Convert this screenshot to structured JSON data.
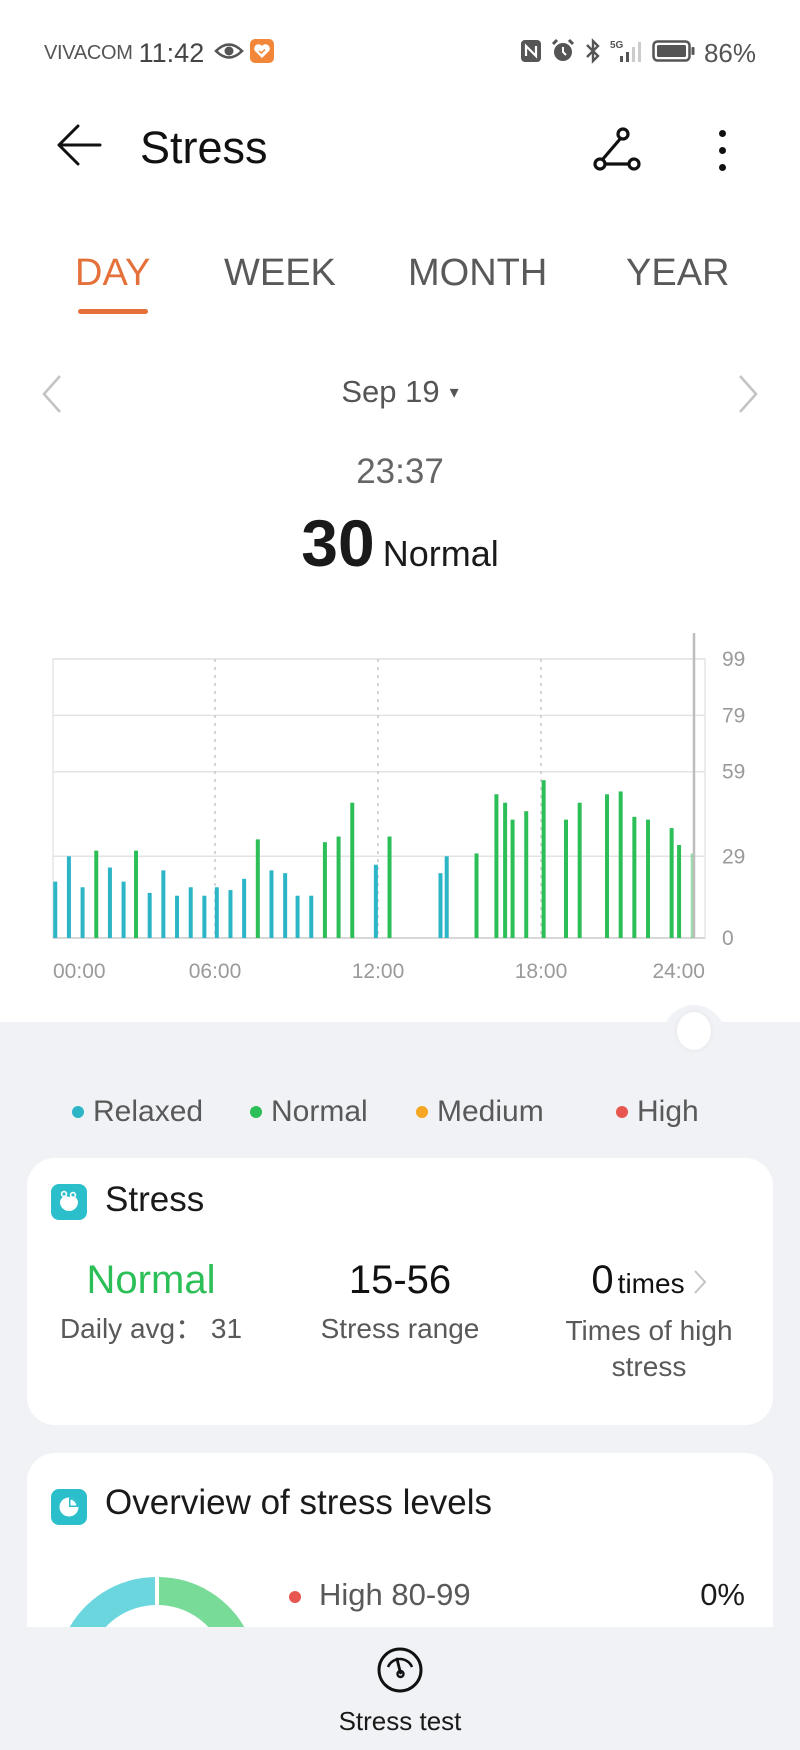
{
  "status_bar": {
    "carrier": "VIVACOM",
    "time": "11:42",
    "icons_left": [
      "eye-icon",
      "health-app-notification-icon"
    ],
    "icons_right": [
      "nfc-icon",
      "alarm-icon",
      "bluetooth-icon",
      "5g-signal-icon",
      "battery-icon"
    ],
    "battery_percent": "86%"
  },
  "header": {
    "title": "Stress",
    "back_icon": "arrow-left-icon",
    "share_icon": "share-icon",
    "more_icon": "more-vertical-icon"
  },
  "tabs": [
    {
      "label": "DAY",
      "active": true
    },
    {
      "label": "WEEK",
      "active": false
    },
    {
      "label": "MONTH",
      "active": false
    },
    {
      "label": "YEAR",
      "active": false
    }
  ],
  "date_nav": {
    "date": "Sep 19",
    "caret": "▾"
  },
  "reading": {
    "time": "23:37",
    "value": "30",
    "level": "Normal"
  },
  "colors": {
    "accent": "#e4703a",
    "relaxed": "#2bb5c6",
    "normal": "#2dbf57",
    "medium": "#f5a623",
    "high": "#e85650",
    "card_icon": "#2bbfcc",
    "background_gray": "#f1f2f6"
  },
  "chart_data": {
    "type": "bar",
    "title": "",
    "xlabel": "",
    "ylabel": "",
    "x_unit": "hour of day",
    "xlim": [
      0,
      24
    ],
    "ylim": [
      0,
      99
    ],
    "y_ticks": [
      0,
      29,
      59,
      79,
      99
    ],
    "x_ticks": [
      "00:00",
      "06:00",
      "12:00",
      "18:00",
      "24:00"
    ],
    "grid": true,
    "selected_time": "23:37",
    "bars": [
      {
        "t": 0.05,
        "value": 20,
        "level": "relaxed"
      },
      {
        "t": 0.6,
        "value": 29,
        "level": "relaxed"
      },
      {
        "t": 1.15,
        "value": 18,
        "level": "relaxed"
      },
      {
        "t": 1.7,
        "value": 31,
        "level": "normal"
      },
      {
        "t": 2.25,
        "value": 25,
        "level": "relaxed"
      },
      {
        "t": 2.8,
        "value": 20,
        "level": "relaxed"
      },
      {
        "t": 3.3,
        "value": 31,
        "level": "normal"
      },
      {
        "t": 3.85,
        "value": 16,
        "level": "relaxed"
      },
      {
        "t": 4.4,
        "value": 24,
        "level": "relaxed"
      },
      {
        "t": 4.95,
        "value": 15,
        "level": "relaxed"
      },
      {
        "t": 5.5,
        "value": 18,
        "level": "relaxed"
      },
      {
        "t": 6.05,
        "value": 15,
        "level": "relaxed"
      },
      {
        "t": 6.55,
        "value": 18,
        "level": "relaxed"
      },
      {
        "t": 7.1,
        "value": 17,
        "level": "relaxed"
      },
      {
        "t": 7.65,
        "value": 21,
        "level": "relaxed"
      },
      {
        "t": 8.2,
        "value": 35,
        "level": "normal"
      },
      {
        "t": 8.75,
        "value": 24,
        "level": "relaxed"
      },
      {
        "t": 9.3,
        "value": 23,
        "level": "relaxed"
      },
      {
        "t": 9.8,
        "value": 15,
        "level": "relaxed"
      },
      {
        "t": 10.35,
        "value": 15,
        "level": "relaxed"
      },
      {
        "t": 10.9,
        "value": 34,
        "level": "normal"
      },
      {
        "t": 11.45,
        "value": 36,
        "level": "normal"
      },
      {
        "t": 12.0,
        "value": 48,
        "level": "normal"
      },
      {
        "t": 12.95,
        "value": 26,
        "level": "relaxed"
      },
      {
        "t": 13.5,
        "value": 36,
        "level": "normal"
      },
      {
        "t": 15.55,
        "value": 23,
        "level": "relaxed"
      },
      {
        "t": 15.8,
        "value": 29,
        "level": "relaxed"
      },
      {
        "t": 17.0,
        "value": 30,
        "level": "normal"
      },
      {
        "t": 17.8,
        "value": 51,
        "level": "normal"
      },
      {
        "t": 18.15,
        "value": 48,
        "level": "normal"
      },
      {
        "t": 18.45,
        "value": 42,
        "level": "normal"
      },
      {
        "t": 19.0,
        "value": 45,
        "level": "normal"
      },
      {
        "t": 19.7,
        "value": 56,
        "level": "normal"
      },
      {
        "t": 20.6,
        "value": 42,
        "level": "normal"
      },
      {
        "t": 21.15,
        "value": 48,
        "level": "normal"
      },
      {
        "t": 22.25,
        "value": 51,
        "level": "normal"
      },
      {
        "t": 22.8,
        "value": 52,
        "level": "normal"
      },
      {
        "t": 23.35,
        "value": 43,
        "level": "normal"
      },
      {
        "t": 23.9,
        "value": 42,
        "level": "normal"
      },
      {
        "t": 24.85,
        "value": 39,
        "level": "normal"
      },
      {
        "t": 25.15,
        "value": 33,
        "level": "normal"
      },
      {
        "t": 25.7,
        "value": 30,
        "level": "normal",
        "selected": true
      }
    ]
  },
  "legend": [
    {
      "label": "Relaxed",
      "color": "#2bb5c6"
    },
    {
      "label": "Normal",
      "color": "#2dbf57"
    },
    {
      "label": "Medium",
      "color": "#f5a623"
    },
    {
      "label": "High",
      "color": "#e85650"
    }
  ],
  "stress_card": {
    "title": "Stress",
    "icon": "stress-face-icon",
    "level": "Normal",
    "daily_avg_label": "Daily avg：",
    "daily_avg_value": "31",
    "range_value": "15-56",
    "range_label": "Stress range",
    "high_count": "0",
    "high_count_unit": "times",
    "high_label": "Times of high stress"
  },
  "overview_card": {
    "title": "Overview of stress levels",
    "icon": "pie-chart-icon",
    "rows": [
      {
        "label": "High 80-99",
        "percent": "0%",
        "color": "#e85650"
      }
    ],
    "donut": [
      {
        "level": "Relaxed",
        "color": "#6bd6de"
      },
      {
        "level": "Normal",
        "color": "#78db98"
      }
    ]
  },
  "bottom_action": {
    "label": "Stress test",
    "icon": "gauge-icon"
  }
}
